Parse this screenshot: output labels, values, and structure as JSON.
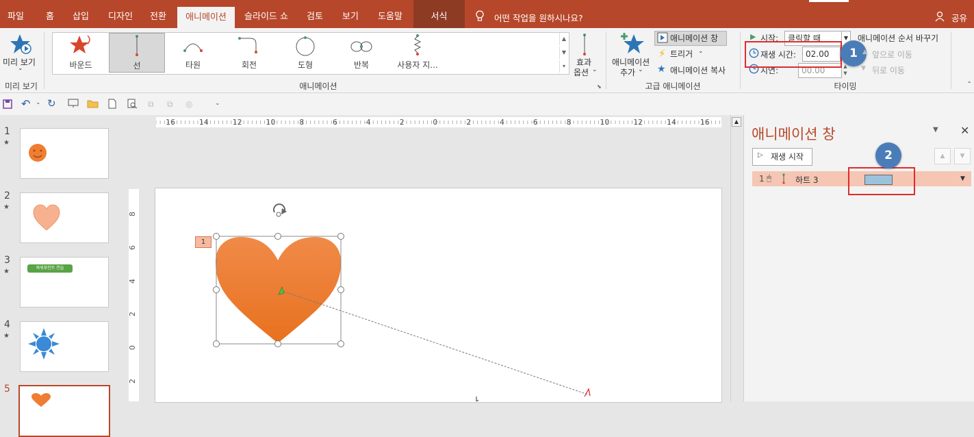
{
  "tabs": [
    "파일",
    "홈",
    "삽입",
    "디자인",
    "전환",
    "애니메이션",
    "슬라이드 쇼",
    "검토",
    "보기",
    "도움말",
    "서식"
  ],
  "active_tab": "애니메이션",
  "tell_me": "어떤 작업을 원하시나요?",
  "share": "공유",
  "ribbon": {
    "preview": {
      "label": "미리 보기",
      "group": "미리 보기"
    },
    "gallery": {
      "group": "애니메이션",
      "items": [
        "바운드",
        "선",
        "타원",
        "회전",
        "도형",
        "반복",
        "사용자 지..."
      ],
      "selected": "선"
    },
    "effect_options": {
      "line1": "효과",
      "line2": "옵션"
    },
    "advanced": {
      "add_line1": "애니메이션",
      "add_line2": "추가",
      "pane_btn": "애니메이션 창",
      "trigger": "트리거",
      "painter": "애니메이션 복사",
      "group": "고급 애니메이션"
    },
    "timing": {
      "start_label": "시작:",
      "start_value": "클릭할 때",
      "duration_label": "재생 시간:",
      "duration_value": "02.00",
      "delay_label": "지연:",
      "delay_value": "00.00",
      "reorder_title": "애니메이션 순서 바꾸기",
      "move_earlier": "앞으로 이동",
      "move_later": "뒤로 이동",
      "group": "타이밍"
    }
  },
  "callouts": [
    "1",
    "2"
  ],
  "ruler": {
    "h_ticks": [
      "16",
      "14",
      "12",
      "10",
      "8",
      "6",
      "4",
      "2",
      "0",
      "2",
      "4",
      "6",
      "8",
      "10",
      "12",
      "14",
      "16"
    ],
    "v_ticks": [
      "8",
      "6",
      "4",
      "2",
      "0",
      "2"
    ]
  },
  "slides": [
    {
      "num": "1",
      "star": "★"
    },
    {
      "num": "2",
      "star": "★"
    },
    {
      "num": "3",
      "star": "★",
      "text": "파워포인트 연습"
    },
    {
      "num": "4",
      "star": "★"
    },
    {
      "num": "5",
      "star": ""
    }
  ],
  "canvas": {
    "anim_tag": "1"
  },
  "pane": {
    "title": "애니메이션 창",
    "play": "재생 시작",
    "item": {
      "num": "1",
      "name": "하트 3"
    }
  },
  "colors": {
    "brand": "#b7472a",
    "heart": "#ef7d32",
    "callout": "#4a7db8",
    "highlight": "#e02a2a"
  }
}
